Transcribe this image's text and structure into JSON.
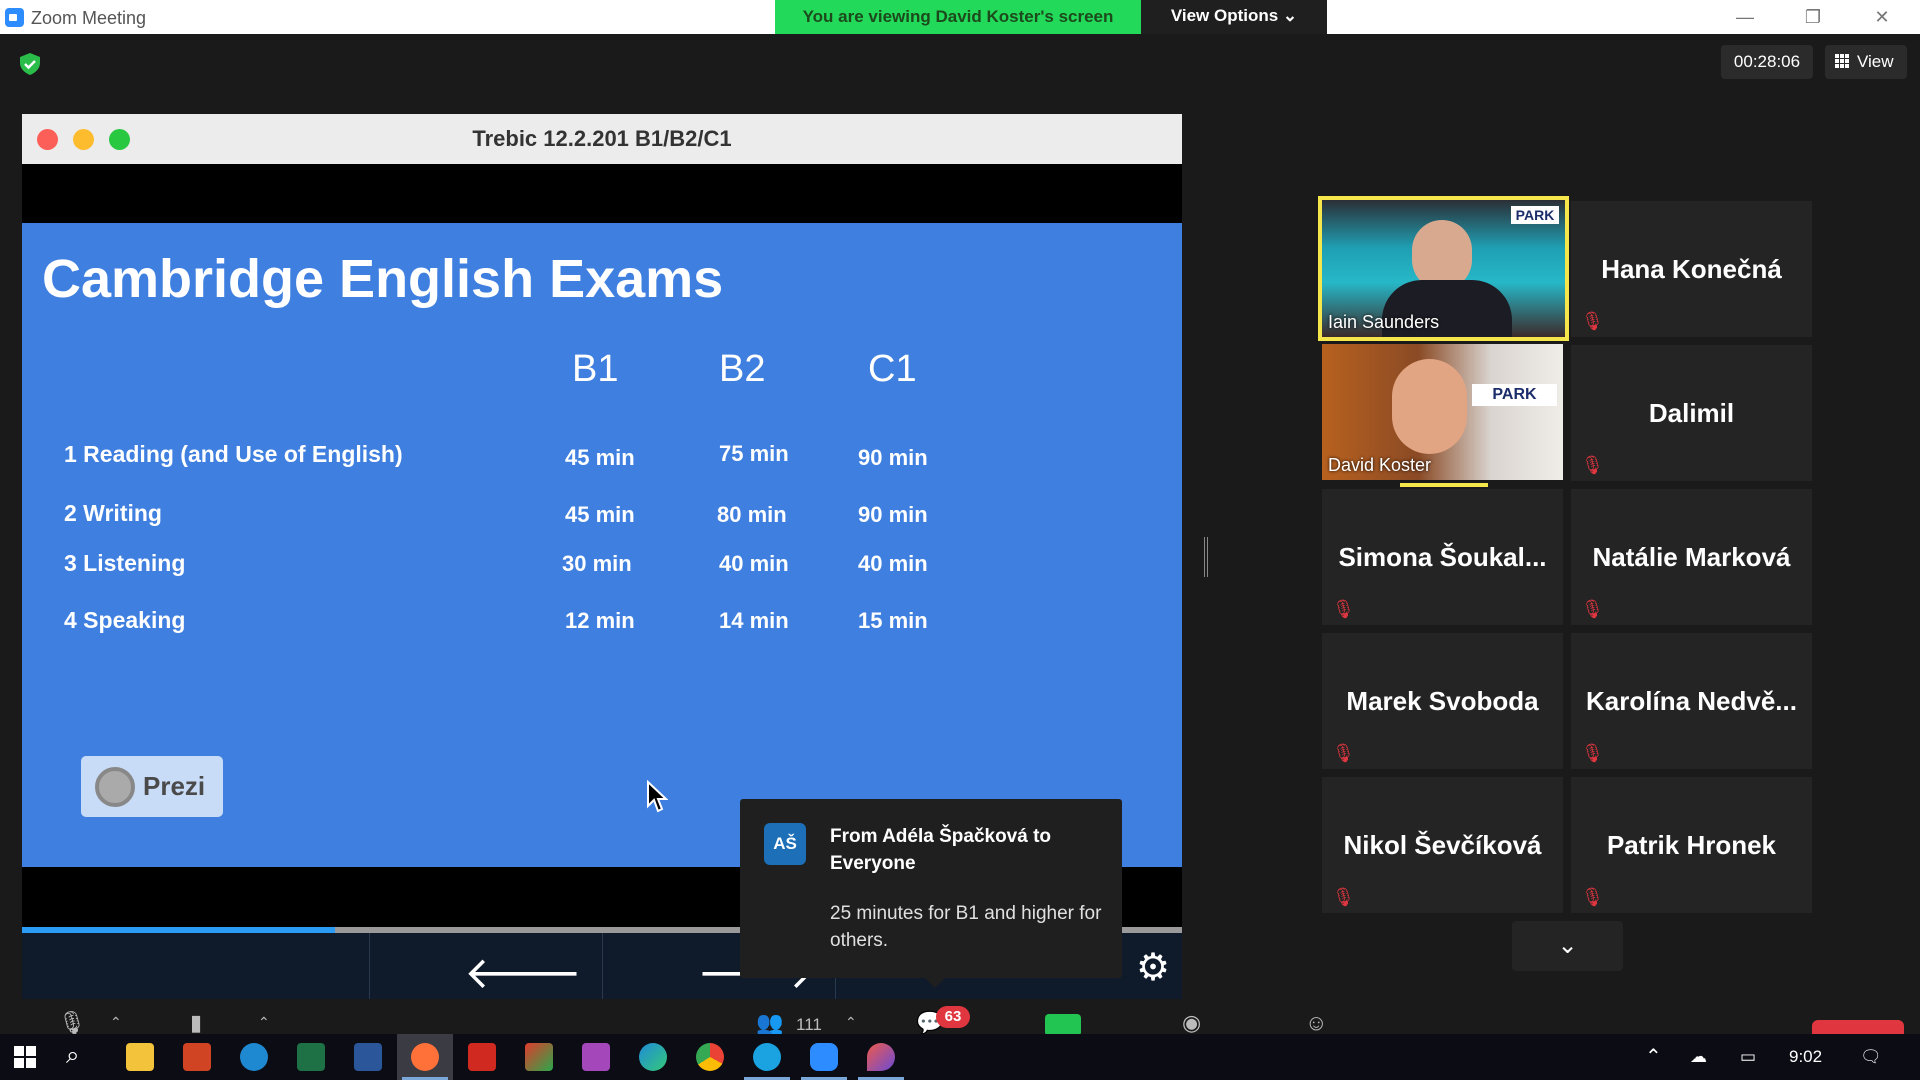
{
  "window": {
    "title": "Zoom Meeting",
    "banner": "You are viewing David Koster's screen",
    "view_options": "View Options ⌄",
    "minimize": "—",
    "restore": "❐",
    "close": "✕"
  },
  "meeting": {
    "timer": "00:28:06",
    "view_label": "View"
  },
  "shared_window": {
    "title": "Trebic 12.2.201 B1/B2/C1",
    "progress_fraction": 0.27
  },
  "slide": {
    "title": "Cambridge English Exams",
    "columns": [
      "B1",
      "B2",
      "C1"
    ],
    "rows": [
      {
        "label": "1 Reading (and Use of English)",
        "values": [
          "45 min",
          "75 min",
          "90 min"
        ]
      },
      {
        "label": "2 Writing",
        "values": [
          "45 min",
          "80 min",
          "90 min"
        ]
      },
      {
        "label": "3 Listening",
        "values": [
          "30 min",
          "40 min",
          "40 min"
        ]
      },
      {
        "label": "4 Speaking",
        "values": [
          "12 min",
          "14 min",
          "15 min"
        ]
      }
    ],
    "logo_text": "Prezi"
  },
  "chat_popup": {
    "avatar": "AŠ",
    "from": "From Adéla Špačková to Everyone",
    "message": "25 minutes for B1 and higher for others."
  },
  "participants": {
    "video": [
      {
        "name": "Iain Saunders",
        "speaking": true
      },
      {
        "name": "David Koster",
        "speaking": false
      }
    ],
    "tiles": [
      {
        "name": "Hana Konečná"
      },
      {
        "name": "Dalimil"
      },
      {
        "name": "Simona  Šoukal..."
      },
      {
        "name": "Natálie Marková"
      },
      {
        "name": "Marek Svoboda"
      },
      {
        "name": "Karolína  Nedvě..."
      },
      {
        "name": "Nikol Ševčíková"
      },
      {
        "name": "Patrik Hronek"
      }
    ]
  },
  "toolbar": {
    "participants_count": "111",
    "chat_badge": "63"
  },
  "taskbar": {
    "clock": "9:02"
  },
  "colors": {
    "banner_green": "#23d959",
    "slide_blue": "#3f7fe0",
    "active_speaker": "#f5e64c",
    "mute_red": "#e0363f"
  }
}
